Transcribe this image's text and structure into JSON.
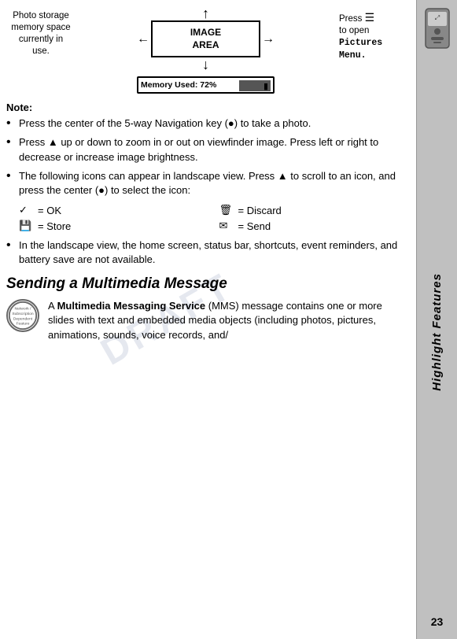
{
  "sidebar": {
    "vertical_label": "Highlight Features",
    "page_number": "23"
  },
  "diagram": {
    "photo_label_line1": "Photo storage",
    "photo_label_line2": "memory space",
    "photo_label_line3": "currently in",
    "photo_label_line4": "use.",
    "image_area_line1": "IMAGE",
    "image_area_line2": "AREA",
    "press_line1": "Press",
    "press_line2": "to open",
    "pictures_menu": "Pictures Menu.",
    "memory_label": "Memory Used: 72%"
  },
  "note": {
    "heading": "Note:",
    "bullets": [
      "Press the center of the 5-way Navigation key (●) to take a photo.",
      "Press ▲ up or down to zoom in or out on viewfinder image. Press left or right to decrease or increase image brightness.",
      "The following icons can appear in landscape view. Press ▲ to scroll to an icon, and press the center (●) to select the icon:"
    ]
  },
  "icon_legend": [
    {
      "icon": "✓",
      "label": "= OK"
    },
    {
      "icon": "🗑",
      "label": "= Discard"
    },
    {
      "icon": "💾",
      "label": "= Store"
    },
    {
      "icon": "✉",
      "label": "= Send"
    }
  ],
  "bullet_landscape": "In the landscape view, the home screen, status bar, shortcuts, event reminders, and battery save are not available.",
  "sending": {
    "heading": "Sending a Multimedia Message",
    "network_label": "Network /\nSubscription\nDependent\nFeature",
    "intro_bold": "Multimedia Messaging Service",
    "intro_mms": " (MMS)",
    "intro_rest": " message contains one or more slides with text and embedded media objects (including photos, pictures, animations, sounds, voice records, and/"
  }
}
